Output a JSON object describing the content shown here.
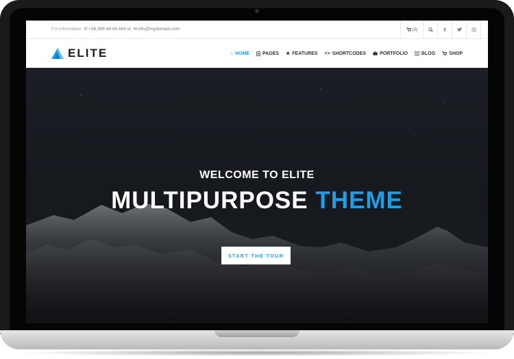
{
  "topbar": {
    "contact_label": "For information",
    "phone": "+39.389.44.44.444",
    "or_text": "or",
    "email": "info@mydomain.com",
    "cart_text": "(0)",
    "icons": [
      "phone-icon",
      "mail-icon",
      "cart-icon",
      "search-icon",
      "facebook-icon",
      "twitter-icon",
      "dribbble-icon"
    ]
  },
  "navbar": {
    "logo_text": "ELITE",
    "menu": [
      {
        "label": "HOME",
        "icon": "home-icon",
        "active": true
      },
      {
        "label": "PAGES",
        "icon": "pages-icon",
        "active": false
      },
      {
        "label": "FEATURES",
        "icon": "star-icon",
        "active": false
      },
      {
        "label": "SHORTCODES",
        "icon": "code-icon",
        "active": false
      },
      {
        "label": "PORTFOLIO",
        "icon": "briefcase-icon",
        "active": false
      },
      {
        "label": "BLOG",
        "icon": "book-icon",
        "active": false
      },
      {
        "label": "SHOP",
        "icon": "cart-icon",
        "active": false
      }
    ]
  },
  "hero": {
    "subtitle": "WELCOME TO ELITE",
    "title_main": "MULTIPURPOSE",
    "title_accent": "THEME",
    "cta": "START THE TOUR"
  },
  "colors": {
    "accent": "#1e9ee8",
    "hero_bg": "#16191e",
    "text_dark": "#1b1b1b"
  }
}
